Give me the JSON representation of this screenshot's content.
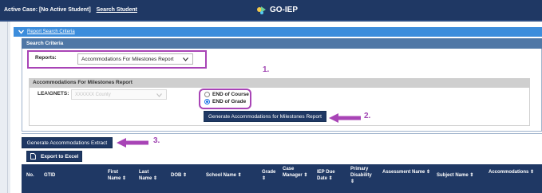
{
  "topbar": {
    "active_case_label": "Active Case: [No Active Student]",
    "search_student_link": "Search Student",
    "brand_name": "GO-IEP"
  },
  "criteria_toggle": {
    "label": "Report Search Criteria"
  },
  "search_criteria": {
    "header": "Search Criteria",
    "reports_label": "Reports:",
    "reports_selected": "Accommodations For Milestones Report"
  },
  "report_panel": {
    "header": "Accommodations For Milestones Report",
    "lea_label": "LEA\\GNETS:",
    "lea_value": "XXXXXX County",
    "radio_options": [
      "END of Course",
      "END of Grade"
    ],
    "radio_selected": "END of Grade",
    "generate_button": "Generate Accommodations for Milestones Report"
  },
  "extract_button": "Generate Accommodations Extract",
  "export_button": "Export to Excel",
  "table": {
    "columns": [
      "No.",
      "GTID",
      "First Name ⇕",
      "Last Name ⇕",
      "DOB ⇕",
      "School Name ⇕",
      "Grade ⇕",
      "Case Manager ⇕",
      "IEP Due Date ⇕",
      "Primary Disability ⇕",
      "Assessment Name ⇕",
      "Subject Name ⇕",
      "Accommodations ⇕"
    ]
  },
  "annotations": {
    "step1": "1.",
    "step2": "2.",
    "step3": "3.",
    "color": "#a844b6"
  },
  "colors": {
    "navy": "#1f3864",
    "accent_blue": "#3c8ddc",
    "panel_header": "#4f77a6"
  }
}
